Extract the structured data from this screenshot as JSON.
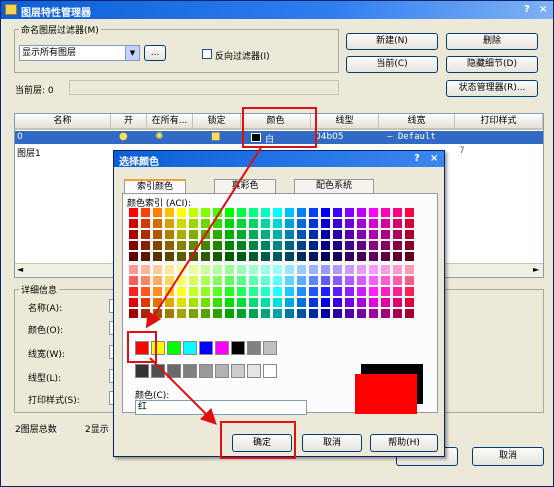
{
  "window": {
    "title": "图层特性管理器",
    "help_glyph": "?",
    "close_glyph": "×"
  },
  "filter_group": {
    "label": "命名图层过滤器(M)",
    "combo_value": "显示所有图层",
    "browse_label": "...",
    "invert_label": "反向过滤器(I)"
  },
  "right_buttons": {
    "new": "新建(N)",
    "delete": "删除",
    "current": "当前(C)",
    "hide_details": "隐藏细节(D)",
    "state_manager": "状态管理器(R)..."
  },
  "current_layer": "当前层: 0",
  "table": {
    "columns": [
      "名称",
      "开",
      "在所有...",
      "锁定",
      "颜色",
      "线型",
      "线宽",
      "打印样式"
    ],
    "rows": [
      {
        "name": "0",
        "color": "白",
        "linetype": "04b05",
        "lineweight": "— Default"
      },
      {
        "name": "图层1",
        "plot": "7"
      }
    ]
  },
  "details": {
    "label": "详细信息",
    "name_label": "名称(A):",
    "color_label": "颜色(O):",
    "lineweight_label": "线宽(W):",
    "linetype_label": "线型(L):",
    "plotstyle_label": "打印样式(S):"
  },
  "status": {
    "total": "2图层总数",
    "shown": "2显示"
  },
  "main_cancel": "取消",
  "color_dialog": {
    "title": "选择颜色",
    "help_glyph": "?",
    "close_glyph": "×",
    "tabs": [
      "索引颜色",
      "真彩色",
      "配色系统"
    ],
    "aci_label": "颜色索引 (ACI):",
    "color_field_label": "颜色(C):",
    "color_value": "红",
    "ok": "确定",
    "cancel": "取消",
    "help": "帮助(H)",
    "standard_colors": [
      "#ff0000",
      "#ffff00",
      "#00ff00",
      "#00ffff",
      "#0000ff",
      "#ff00ff",
      "#000000",
      "#808080",
      "#c0c0c0"
    ],
    "gray_colors": [
      "#333333",
      "#505050",
      "#696969",
      "#808080",
      "#999999",
      "#b2b2b2",
      "#cccccc",
      "#e5e5e5",
      "#ffffff"
    ],
    "new_color": "#ff0000",
    "old_color": "#000000"
  },
  "accent": {
    "highlight": "#e01010",
    "selection": "#316ac5"
  }
}
